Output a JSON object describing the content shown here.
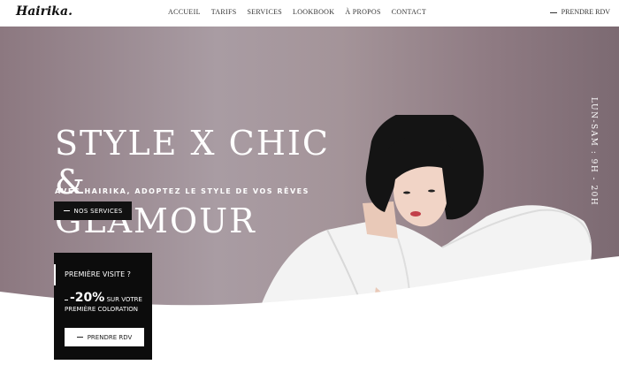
{
  "header": {
    "logo": "Hairika.",
    "nav": [
      "ACCUEIL",
      "TARIFS",
      "SERVICES",
      "LOOKBOOK",
      "À PROPOS",
      "CONTACT"
    ],
    "cta": "PRENDRE RDV"
  },
  "hero": {
    "title_line1": "STYLE X CHIC &",
    "title_line2": "GLAMOUR",
    "subtitle": "AVEC HAIRIKA, ADOPTEZ LE STYLE DE VOS RÊVES",
    "button": "NOS SERVICES",
    "hours": "LUN-SAM : 9H - 20H"
  },
  "promo": {
    "heading": "PREMIÈRE VISITE ?",
    "percent": "-20%",
    "offer_line1": "SUR VOTRE",
    "offer_line2": "PREMIÈRE COLORATION",
    "button": "PRENDRE RDV"
  },
  "colors": {
    "hero_bg": "#a49499",
    "dark": "#0c0c0c",
    "white": "#ffffff"
  }
}
